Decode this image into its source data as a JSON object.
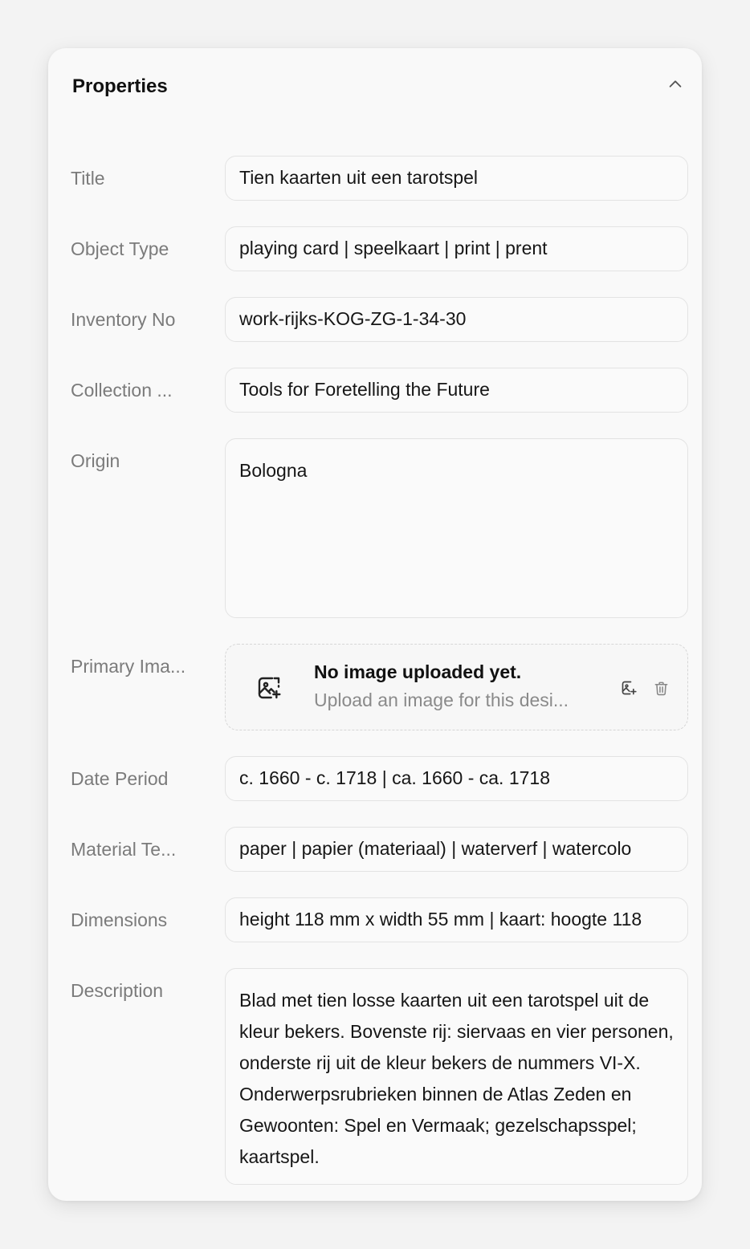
{
  "panel": {
    "title": "Properties"
  },
  "fields": {
    "title": {
      "label": "Title",
      "value": "Tien kaarten uit een tarotspel"
    },
    "object_type": {
      "label": "Object Type",
      "value": "playing card | speelkaart | print | prent"
    },
    "inventory_no": {
      "label": "Inventory No",
      "value": "work-rijks-KOG-ZG-1-34-30"
    },
    "collection": {
      "label": "Collection ...",
      "value": "Tools for Foretelling the Future"
    },
    "origin": {
      "label": "Origin",
      "value": "Bologna"
    },
    "primary_image": {
      "label": "Primary Ima...",
      "empty_title": "No image uploaded yet.",
      "empty_subtitle": "Upload an image for this desi..."
    },
    "date_period": {
      "label": "Date Period",
      "value": "c. 1660 - c. 1718 | ca. 1660 - ca. 1718"
    },
    "material": {
      "label": "Material Te...",
      "value": "paper | papier (materiaal) | waterverf | watercolo"
    },
    "dimensions": {
      "label": "Dimensions",
      "value": "height 118 mm x width 55 mm | kaart: hoogte 118"
    },
    "description": {
      "label": "Description",
      "value": "Blad met tien losse kaarten uit een tarotspel uit de kleur bekers. Bovenste rij: siervaas en vier personen, onderste rij uit de kleur bekers de nummers VI-X. Onderwerpsrubrieken binnen de Atlas Zeden en Gewoonten: Spel en Vermaak; gezelschapsspel; kaartspel."
    }
  },
  "icons": {
    "collapse": "chevron-up-icon",
    "upload_placeholder": "image-plus-icon",
    "replace_image": "image-plus-icon",
    "delete_image": "trash-icon"
  }
}
